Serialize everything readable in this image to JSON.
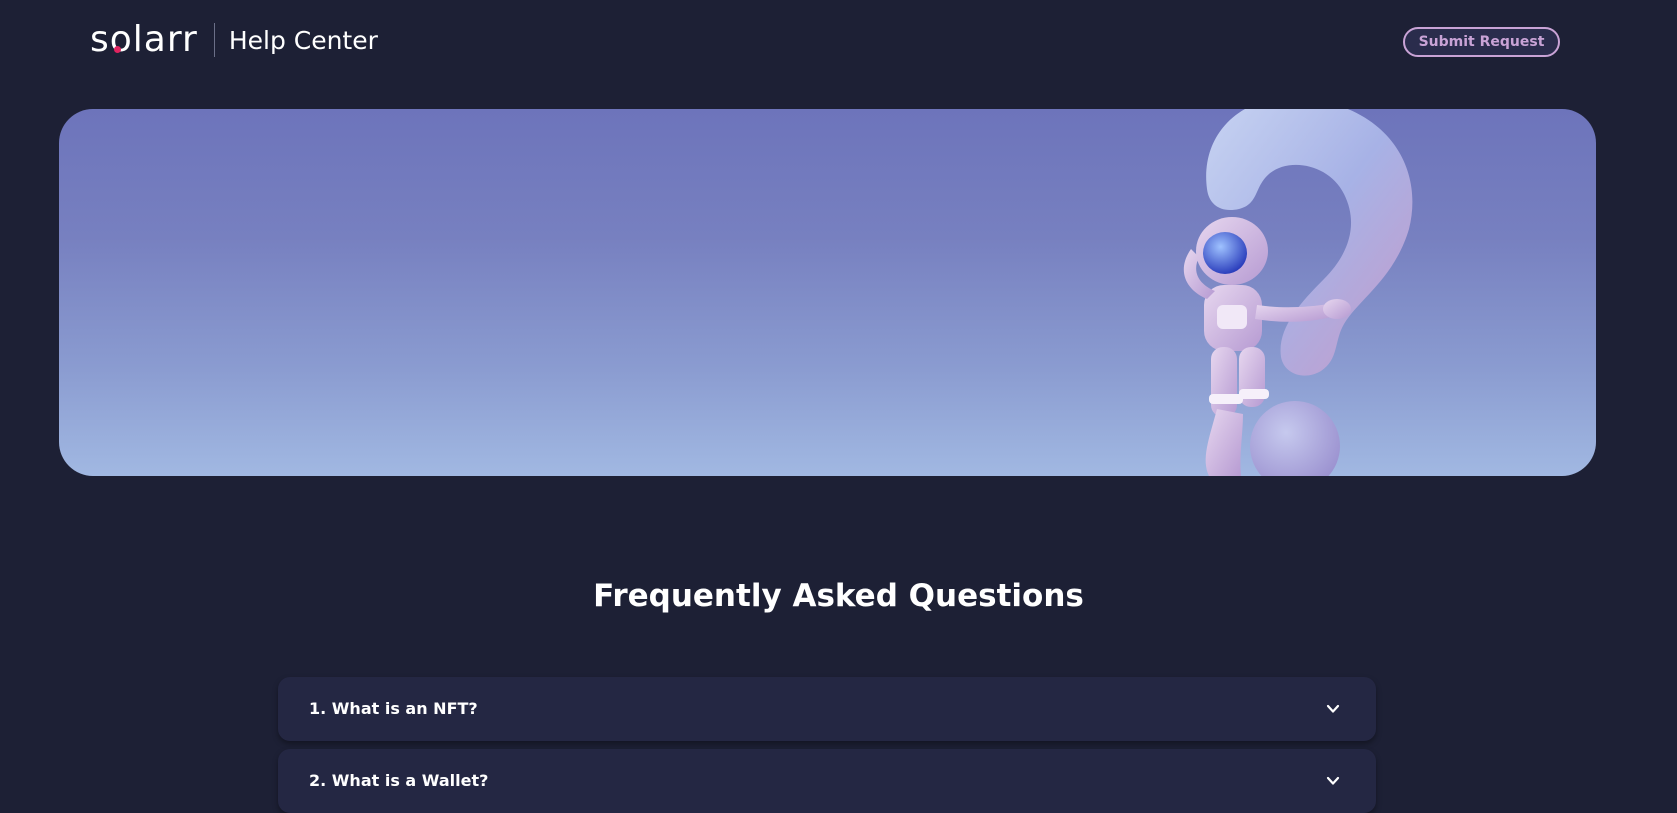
{
  "header": {
    "logo_text": "solarr",
    "site_section": "Help Center",
    "submit_label": "Submit Request"
  },
  "hero": {
    "image": "astronaut-with-question-mark"
  },
  "faq": {
    "title": "Frequently Asked Questions",
    "items": [
      {
        "question": "1. What is an NFT?",
        "icon": "chevron-down-icon"
      },
      {
        "question": "2. What is a Wallet?",
        "icon": "chevron-down-icon"
      }
    ]
  },
  "colors": {
    "background": "#1d2035",
    "card": "#242743",
    "accent": "#c9a3d6",
    "logo_dot": "#e0235f"
  }
}
